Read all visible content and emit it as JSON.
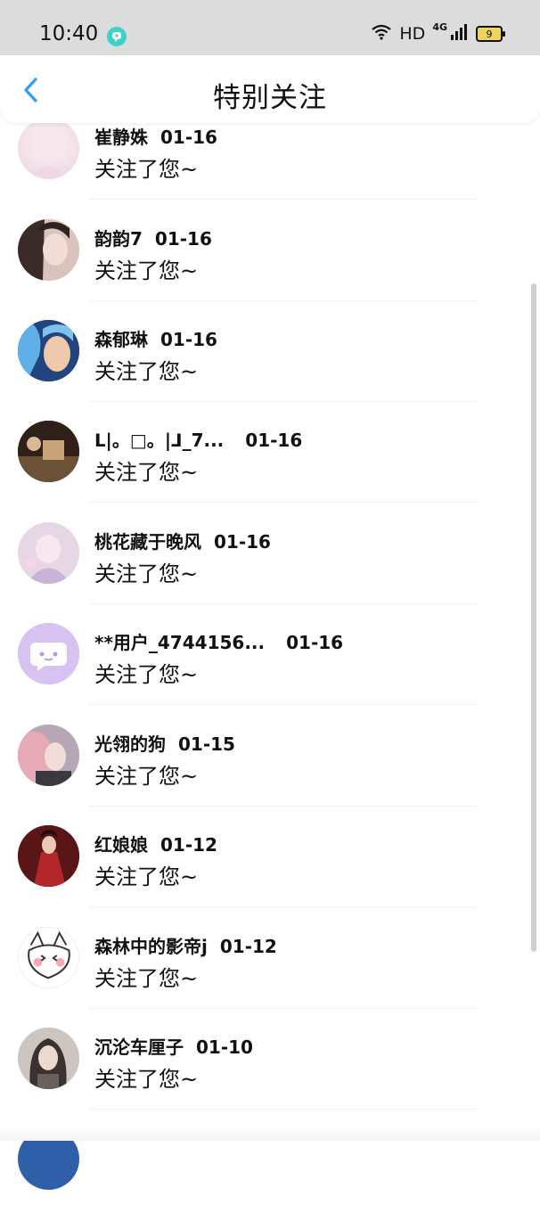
{
  "status_bar": {
    "time": "10:40",
    "network_type": "4G",
    "hd_label": "HD",
    "battery_level": "9"
  },
  "header": {
    "title": "特别关注",
    "back_icon": "chevron-left-icon",
    "accent_color": "#2e9df7"
  },
  "notifications": [
    {
      "name": "崔静姝",
      "date": "01-16",
      "message": "关注了您~"
    },
    {
      "name": "韵韵7",
      "date": "01-16",
      "message": "关注了您~"
    },
    {
      "name": "森郁琳",
      "date": "01-16",
      "message": "关注了您~"
    },
    {
      "name": "ᒪ|。□。|ᒧ_7...",
      "date": "01-16",
      "message": "关注了您~"
    },
    {
      "name": "桃花藏于晚风",
      "date": "01-16",
      "message": "关注了您~"
    },
    {
      "name": "**用户_4744156...",
      "date": "01-16",
      "message": "关注了您~"
    },
    {
      "name": "光翎的狗",
      "date": "01-15",
      "message": "关注了您~"
    },
    {
      "name": "红娘娘",
      "date": "01-12",
      "message": "关注了您~"
    },
    {
      "name": "森林中的影帝j",
      "date": "01-12",
      "message": "关注了您~"
    },
    {
      "name": "沉沦车厘子",
      "date": "01-10",
      "message": "关注了您~"
    }
  ]
}
